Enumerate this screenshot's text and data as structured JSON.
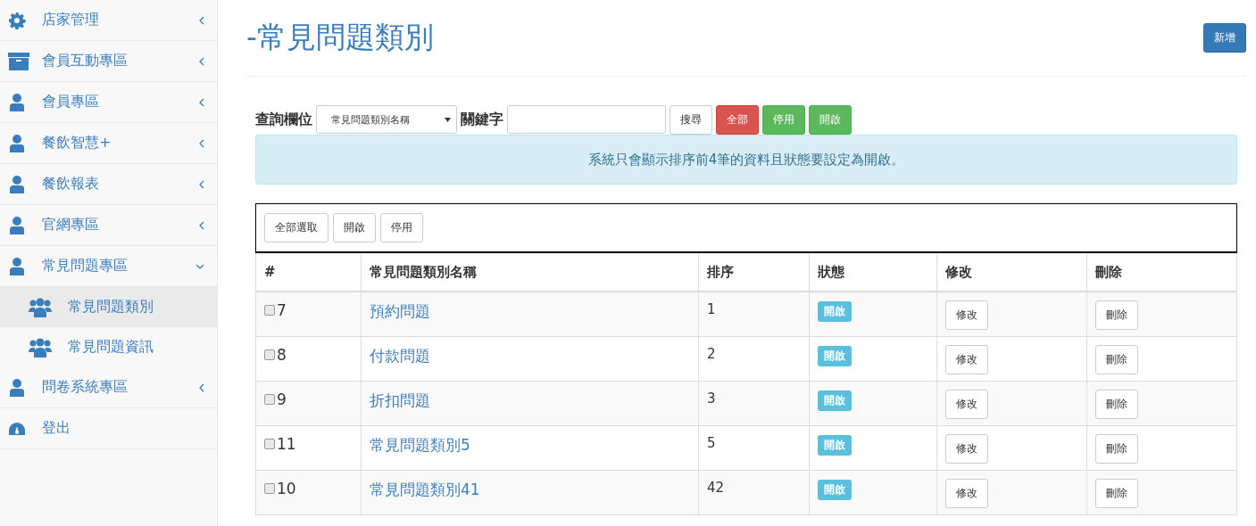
{
  "sidebar": {
    "items": [
      {
        "label": "店家管理",
        "kind": "gear",
        "expanded": false
      },
      {
        "label": "會員互動專區",
        "kind": "archive",
        "expanded": false
      },
      {
        "label": "會員專區",
        "kind": "user",
        "expanded": false
      },
      {
        "label": "餐飲智慧+",
        "kind": "user",
        "expanded": false
      },
      {
        "label": "餐飲報表",
        "kind": "user",
        "expanded": false
      },
      {
        "label": "官網專區",
        "kind": "user",
        "expanded": false
      },
      {
        "label": "常見問題專區",
        "kind": "user",
        "expanded": true,
        "children": [
          {
            "label": "常見問題類別",
            "selected": true
          },
          {
            "label": "常見問題資訊",
            "selected": false
          }
        ]
      },
      {
        "label": "問卷系統專區",
        "kind": "user",
        "expanded": false
      },
      {
        "label": "登出",
        "kind": "dashboard"
      }
    ]
  },
  "page": {
    "title": "-常見問題類別",
    "add_button": "新增"
  },
  "filter": {
    "field_label": "查詢欄位",
    "field_value": "常見問題類別名稱",
    "keyword_label": "關鍵字",
    "search_button": "搜尋",
    "buttons": [
      {
        "label": "全部",
        "kind": "danger"
      },
      {
        "label": "停用",
        "kind": "success"
      },
      {
        "label": "開啟",
        "kind": "success"
      }
    ]
  },
  "notice": "系統只會顯示排序前4筆的資料且狀態要設定為開啟。",
  "bulk_buttons": [
    "全部選取",
    "開啟",
    "停用"
  ],
  "table": {
    "columns": [
      "#",
      "常見問題類別名稱",
      "排序",
      "狀態",
      "修改",
      "刪除"
    ],
    "rows": [
      {
        "checked": false,
        "id": "7",
        "name": "預約問題",
        "order": "1",
        "status": "開啟",
        "edit": "修改",
        "delete": "刪除"
      },
      {
        "checked": false,
        "id": "8",
        "name": "付款問題",
        "order": "2",
        "status": "開啟",
        "edit": "修改",
        "delete": "刪除"
      },
      {
        "checked": false,
        "id": "9",
        "name": "折扣問題",
        "order": "3",
        "status": "開啟",
        "edit": "修改",
        "delete": "刪除"
      },
      {
        "checked": false,
        "id": "11",
        "name": "常見問題類別5",
        "order": "5",
        "status": "開啟",
        "edit": "修改",
        "delete": "刪除"
      },
      {
        "checked": false,
        "id": "10",
        "name": "常見問題類別41",
        "order": "42",
        "status": "開啟",
        "edit": "修改",
        "delete": "刪除"
      }
    ]
  }
}
